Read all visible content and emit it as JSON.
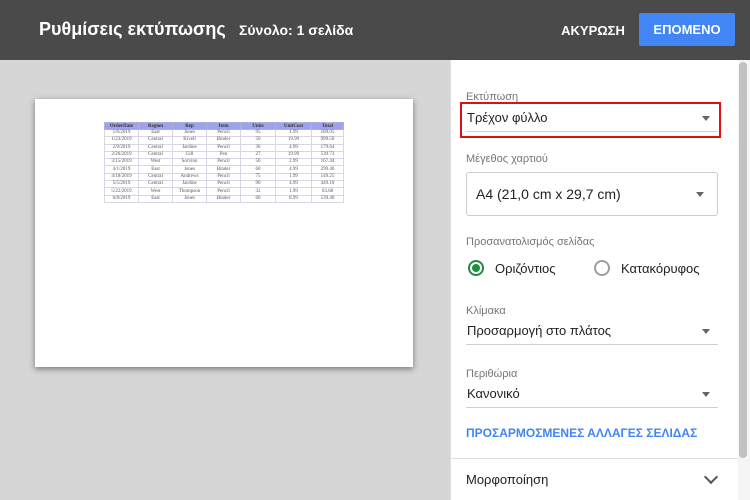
{
  "header": {
    "title": "Ρυθμίσεις εκτύπωσης",
    "total": "Σύνολο: 1 σελίδα",
    "cancel_label": "ΑΚΥΡΩΣΗ",
    "next_label": "ΕΠΟΜΕΝΟ",
    "accent": "#4285f4"
  },
  "preview": {
    "headers": [
      "OrderDate",
      "Region",
      "Rep",
      "Item",
      "Units",
      "UnitCost",
      "Total"
    ],
    "rows": [
      [
        "1/6/2019",
        "East",
        "Jones",
        "Pencil",
        "95",
        "1.99",
        "189.05"
      ],
      [
        "1/23/2019",
        "Central",
        "Kivell",
        "Binder",
        "50",
        "19.99",
        "999.50"
      ],
      [
        "2/9/2019",
        "Central",
        "Jardine",
        "Pencil",
        "36",
        "4.99",
        "179.64"
      ],
      [
        "2/26/2019",
        "Central",
        "Gill",
        "Pen",
        "27",
        "19.99",
        "539.73"
      ],
      [
        "3/15/2019",
        "West",
        "Sorvino",
        "Pencil",
        "56",
        "2.99",
        "167.44"
      ],
      [
        "4/1/2019",
        "East",
        "Jones",
        "Binder",
        "60",
        "4.99",
        "299.40"
      ],
      [
        "4/18/2019",
        "Central",
        "Andrews",
        "Pencil",
        "75",
        "1.99",
        "149.25"
      ],
      [
        "5/5/2019",
        "Central",
        "Jardine",
        "Pencil",
        "90",
        "4.99",
        "449.10"
      ],
      [
        "5/22/2019",
        "West",
        "Thompson",
        "Pencil",
        "32",
        "1.99",
        "63.68"
      ],
      [
        "6/8/2019",
        "East",
        "Jones",
        "Binder",
        "60",
        "8.99",
        "539.40"
      ]
    ]
  },
  "settings": {
    "print_label": "Εκτύπωση",
    "print_value": "Τρέχον φύλλο",
    "paper_label": "Μέγεθος χαρτιού",
    "paper_value": "A4 (21,0 cm x 29,7 cm)",
    "orientation_label": "Προσανατολισμός σελίδας",
    "orientation_landscape": "Οριζόντιος",
    "orientation_portrait": "Κατακόρυφος",
    "scale_label": "Κλίμακα",
    "scale_value": "Προσαρμογή στο πλάτος",
    "margins_label": "Περιθώρια",
    "margins_value": "Κανονικό",
    "custom_breaks": "ΠΡΟΣΑΡΜΟΣΜΕΝΕΣ ΑΛΛΑΓΕΣ ΣΕΛΙΔΑΣ",
    "formatting_label": "Μορφοποίηση",
    "selected_orientation_color": "#1e8e3e",
    "highlight_color": "#e01010"
  }
}
